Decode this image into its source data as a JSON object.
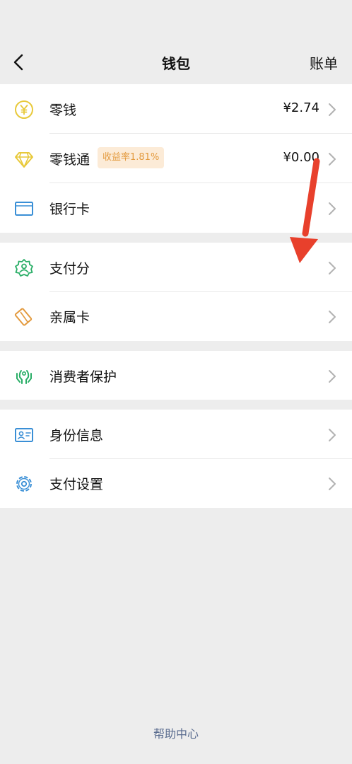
{
  "header": {
    "title": "钱包",
    "bill_label": "账单"
  },
  "groups": [
    {
      "items": [
        {
          "label": "零钱",
          "value": "¥2.74",
          "icon": "yuan-coin-icon"
        },
        {
          "label": "零钱通",
          "value": "¥0.00",
          "badge": "收益率1.81%",
          "icon": "diamond-icon"
        },
        {
          "label": "银行卡",
          "icon": "bank-card-icon"
        }
      ]
    },
    {
      "items": [
        {
          "label": "支付分",
          "icon": "payscore-icon"
        },
        {
          "label": "亲属卡",
          "icon": "family-card-icon"
        }
      ]
    },
    {
      "items": [
        {
          "label": "消费者保护",
          "icon": "consumer-protection-icon"
        }
      ]
    },
    {
      "items": [
        {
          "label": "身份信息",
          "icon": "id-card-icon"
        },
        {
          "label": "支付设置",
          "icon": "settings-gear-icon"
        }
      ]
    }
  ],
  "footer": {
    "help_label": "帮助中心"
  },
  "colors": {
    "page_bg": "#ededed",
    "yuan_icon": "#e8c93a",
    "diamond_icon": "#e8c93a",
    "card_icon": "#3a8fd6",
    "green_icon": "#2aae67",
    "family_icon": "#e39a3e",
    "badge_bg": "#fcebd7",
    "badge_text": "#e39a3e",
    "arrow": "#e8402c",
    "help_link": "#5a6c8f"
  }
}
